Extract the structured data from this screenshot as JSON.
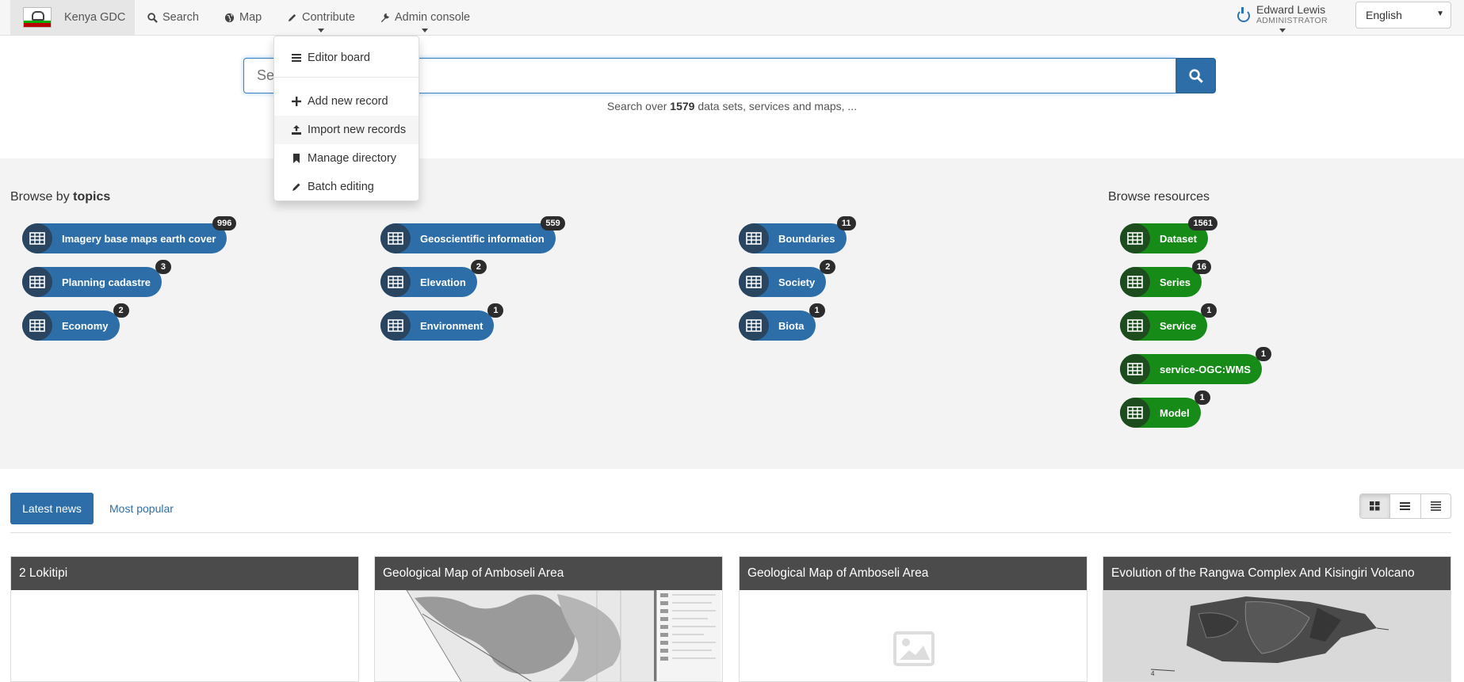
{
  "nav": {
    "brand": "Kenya GDC",
    "items": [
      {
        "label": "Search",
        "icon": "search-icon"
      },
      {
        "label": "Map",
        "icon": "globe-icon"
      },
      {
        "label": "Contribute",
        "icon": "pencil-icon"
      },
      {
        "label": "Admin console",
        "icon": "wrench-icon"
      }
    ],
    "user": {
      "name": "Edward Lewis",
      "role": "ADMINISTRATOR"
    },
    "language": "English"
  },
  "dropdown": {
    "items": [
      {
        "label": "Editor board",
        "icon": "list-icon"
      },
      {
        "label": "Add new record",
        "icon": "plus-icon"
      },
      {
        "label": "Import new records",
        "icon": "upload-icon"
      },
      {
        "label": "Manage directory",
        "icon": "bookmark-icon"
      },
      {
        "label": "Batch editing",
        "icon": "pencil-icon"
      }
    ]
  },
  "search": {
    "placeholder": "Search...",
    "hint_prefix": "Search over",
    "count": "1579",
    "hint_suffix": "data sets, services and maps, ..."
  },
  "browse": {
    "topics_prefix": "Browse by",
    "topics_bold": "topics",
    "resources_title": "Browse resources",
    "topics": [
      {
        "label": "Imagery base maps earth cover",
        "count": "996"
      },
      {
        "label": "Planning cadastre",
        "count": "3"
      },
      {
        "label": "Economy",
        "count": "2"
      },
      {
        "label": "Geoscientific information",
        "count": "559"
      },
      {
        "label": "Elevation",
        "count": "2"
      },
      {
        "label": "Environment",
        "count": "1"
      },
      {
        "label": "Boundaries",
        "count": "11"
      },
      {
        "label": "Society",
        "count": "2"
      },
      {
        "label": "Biota",
        "count": "1"
      }
    ],
    "resources": [
      {
        "label": "Dataset",
        "count": "1561"
      },
      {
        "label": "Series",
        "count": "16"
      },
      {
        "label": "Service",
        "count": "1"
      },
      {
        "label": "service-OGC:WMS",
        "count": "1"
      },
      {
        "label": "Model",
        "count": "1"
      }
    ]
  },
  "news": {
    "tabs": [
      "Latest news",
      "Most popular"
    ],
    "cards": [
      {
        "title": "2 Lokitipi"
      },
      {
        "title": "Geological Map of Amboseli Area"
      },
      {
        "title": "Geological Map of Amboseli Area"
      },
      {
        "title": "Evolution of the Rangwa Complex And Kisingiri Volcano"
      }
    ]
  },
  "colors": {
    "primary": "#2d6ea8",
    "success": "#168b18",
    "badge": "#2c2c2c"
  }
}
